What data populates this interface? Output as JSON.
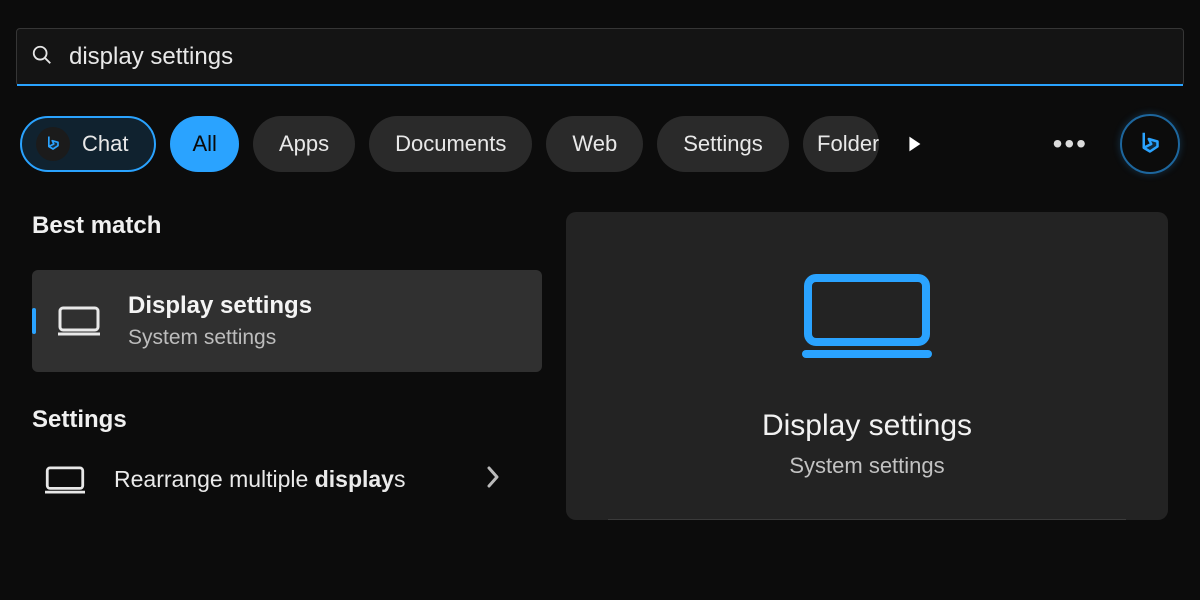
{
  "search": {
    "value": "display settings"
  },
  "filters": {
    "chat": "Chat",
    "all": "All",
    "apps": "Apps",
    "documents": "Documents",
    "web": "Web",
    "settings": "Settings",
    "folders": "Folders"
  },
  "sections": {
    "best_match": "Best match",
    "settings": "Settings"
  },
  "results": {
    "best": {
      "title": "Display settings",
      "subtitle": "System settings"
    },
    "settings_items": [
      {
        "prefix": "Rearrange multiple ",
        "bold": "display",
        "suffix": "s"
      }
    ]
  },
  "detail": {
    "title": "Display settings",
    "subtitle": "System settings"
  }
}
